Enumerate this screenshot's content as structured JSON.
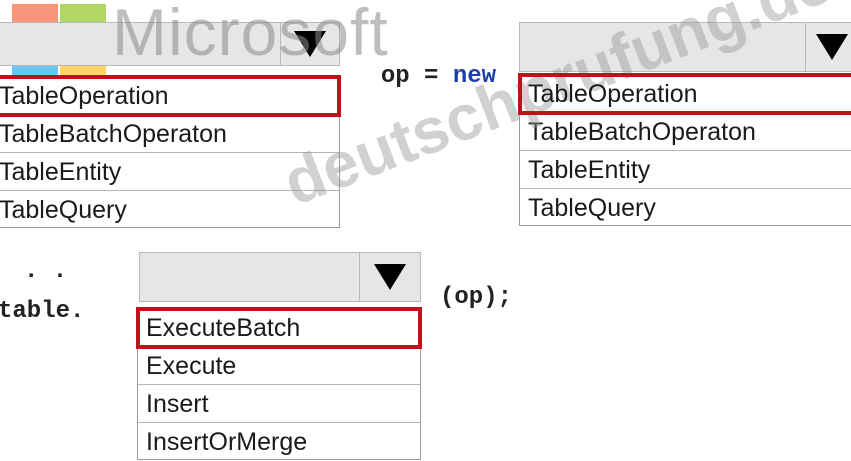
{
  "watermark": {
    "brand": "Microsoft",
    "site": "deutschprufung.de",
    "logo_colors": [
      "#f25022",
      "#7fba00",
      "#00a4ef",
      "#ffb900"
    ]
  },
  "code": {
    "line1_pre": "op = ",
    "line1_keyword": "new",
    "line2_prefix": ". .",
    "line3_prefix": "table.",
    "line3_suffix": "(op);"
  },
  "dropdown1": {
    "selected_value": "",
    "options": [
      "TableOperation",
      "TableBatchOperaton",
      "TableEntity",
      "TableQuery"
    ],
    "highlighted_index": 0
  },
  "dropdown2": {
    "selected_value": "",
    "options": [
      "TableOperation",
      "TableBatchOperaton",
      "TableEntity",
      "TableQuery"
    ],
    "highlighted_index": 0
  },
  "dropdown3": {
    "selected_value": "",
    "options": [
      "ExecuteBatch",
      "Execute",
      "Insert",
      "InsertOrMerge"
    ],
    "highlighted_index": 0
  },
  "colors": {
    "highlight": "#c1121c",
    "keyword": "#1f3fa8"
  }
}
